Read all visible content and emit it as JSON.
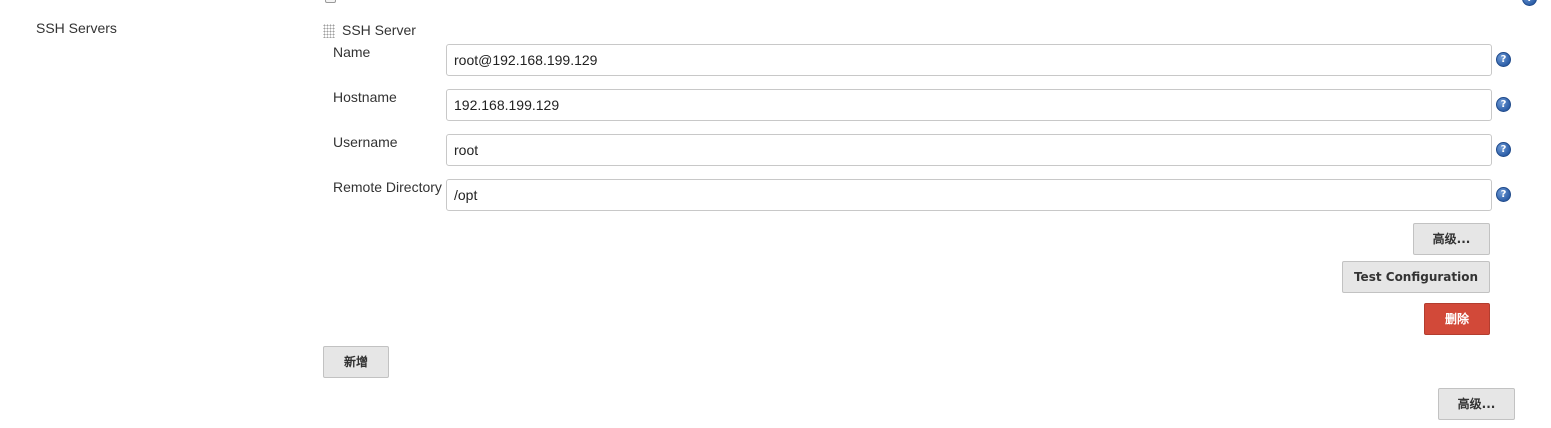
{
  "section": {
    "label": "SSH Servers"
  },
  "server": {
    "title": "SSH Server",
    "fields": [
      {
        "label": "Name",
        "value": "root@192.168.199.129"
      },
      {
        "label": "Hostname",
        "value": "192.168.199.129"
      },
      {
        "label": "Username",
        "value": "root"
      },
      {
        "label": "Remote Directory",
        "value": "/opt"
      }
    ],
    "advanced_label": "高级...",
    "test_label": "Test Configuration",
    "delete_label": "删除"
  },
  "add_label": "新增",
  "advanced_bottom_label": "高级...",
  "help_glyph": "?",
  "colors": {
    "delete_bg": "#d24939",
    "button_bg": "#e6e6e6",
    "help_blue": "#2e5fa8"
  }
}
